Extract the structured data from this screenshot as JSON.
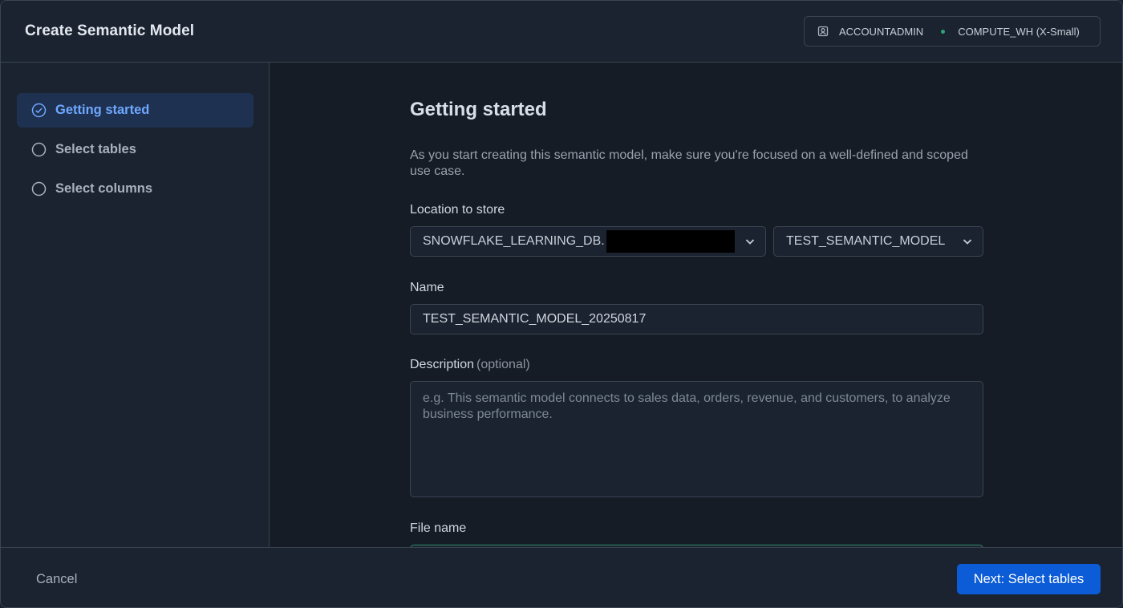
{
  "header": {
    "title": "Create Semantic Model",
    "role": "ACCOUNTADMIN",
    "warehouse": "COMPUTE_WH (X-Small)"
  },
  "sidebar": {
    "steps": [
      {
        "label": "Getting started",
        "active": true,
        "icon": "check-circle-icon"
      },
      {
        "label": "Select tables",
        "active": false,
        "icon": "circle-icon"
      },
      {
        "label": "Select columns",
        "active": false,
        "icon": "circle-icon"
      }
    ]
  },
  "main": {
    "heading": "Getting started",
    "intro": "As you start creating this semantic model, make sure you're focused on a well-defined and scoped use case.",
    "location": {
      "label": "Location to store",
      "database_value": "SNOWFLAKE_LEARNING_DB.",
      "stage_value": "TEST_SEMANTIC_MODEL"
    },
    "name": {
      "label": "Name",
      "value": "TEST_SEMANTIC_MODEL_20250817"
    },
    "description": {
      "label": "Description",
      "optional": "(optional)",
      "placeholder": "e.g. This semantic model connects to sales data, orders, revenue, and customers, to analyze business performance."
    },
    "file_name": {
      "label": "File name"
    }
  },
  "footer": {
    "cancel": "Cancel",
    "next": "Next: Select tables"
  },
  "colors": {
    "accent": "#6ea8ff",
    "primary_button": "#0b5cd6",
    "status_dot": "#2ea37a"
  }
}
